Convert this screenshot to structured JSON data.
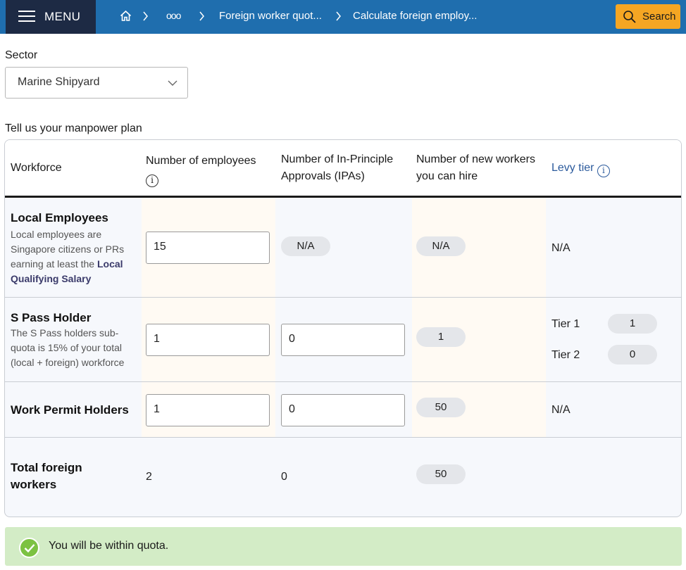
{
  "header": {
    "menu_label": "MENU",
    "breadcrumb": {
      "home_icon": "home-icon",
      "overflow": "ooo",
      "item1": "Foreign worker quot...",
      "item2": "Calculate foreign employ..."
    },
    "search_label": "Search",
    "colors": {
      "bar": "#1f6eae",
      "menu": "#1d2a44",
      "search": "#f5a623"
    }
  },
  "sector": {
    "label": "Sector",
    "value": "Marine Shipyard"
  },
  "plan": {
    "label": "Tell us your manpower plan",
    "columns": {
      "workforce": "Workforce",
      "employees": "Number of employees",
      "ipas": "Number of In-Principle Approvals (IPAs)",
      "new_workers": "Number of new workers you can hire",
      "levy": "Levy tier"
    },
    "rows": {
      "local": {
        "title": "Local Employees",
        "desc_prefix": "Local employees are Singapore citizens or PRs earning at least the ",
        "desc_link": "Local Qualifying Salary",
        "employees": "15",
        "ipas": "N/A",
        "new_workers": "N/A",
        "levy": "N/A"
      },
      "spass": {
        "title": "S Pass Holder",
        "desc": "The S Pass holders sub-quota is 15% of your total (local + foreign) workforce",
        "employees": "1",
        "ipas": "0",
        "new_workers": "1",
        "tier1_label": "Tier 1",
        "tier1_value": "1",
        "tier2_label": "Tier 2",
        "tier2_value": "0"
      },
      "wp": {
        "title": "Work Permit Holders",
        "employees": "1",
        "ipas": "0",
        "new_workers": "50",
        "levy": "N/A"
      },
      "total": {
        "title": "Total foreign workers",
        "employees": "2",
        "ipas": "0",
        "new_workers": "50"
      }
    }
  },
  "status": {
    "text": "You will be within quota.",
    "color": "#d3ecc6"
  }
}
